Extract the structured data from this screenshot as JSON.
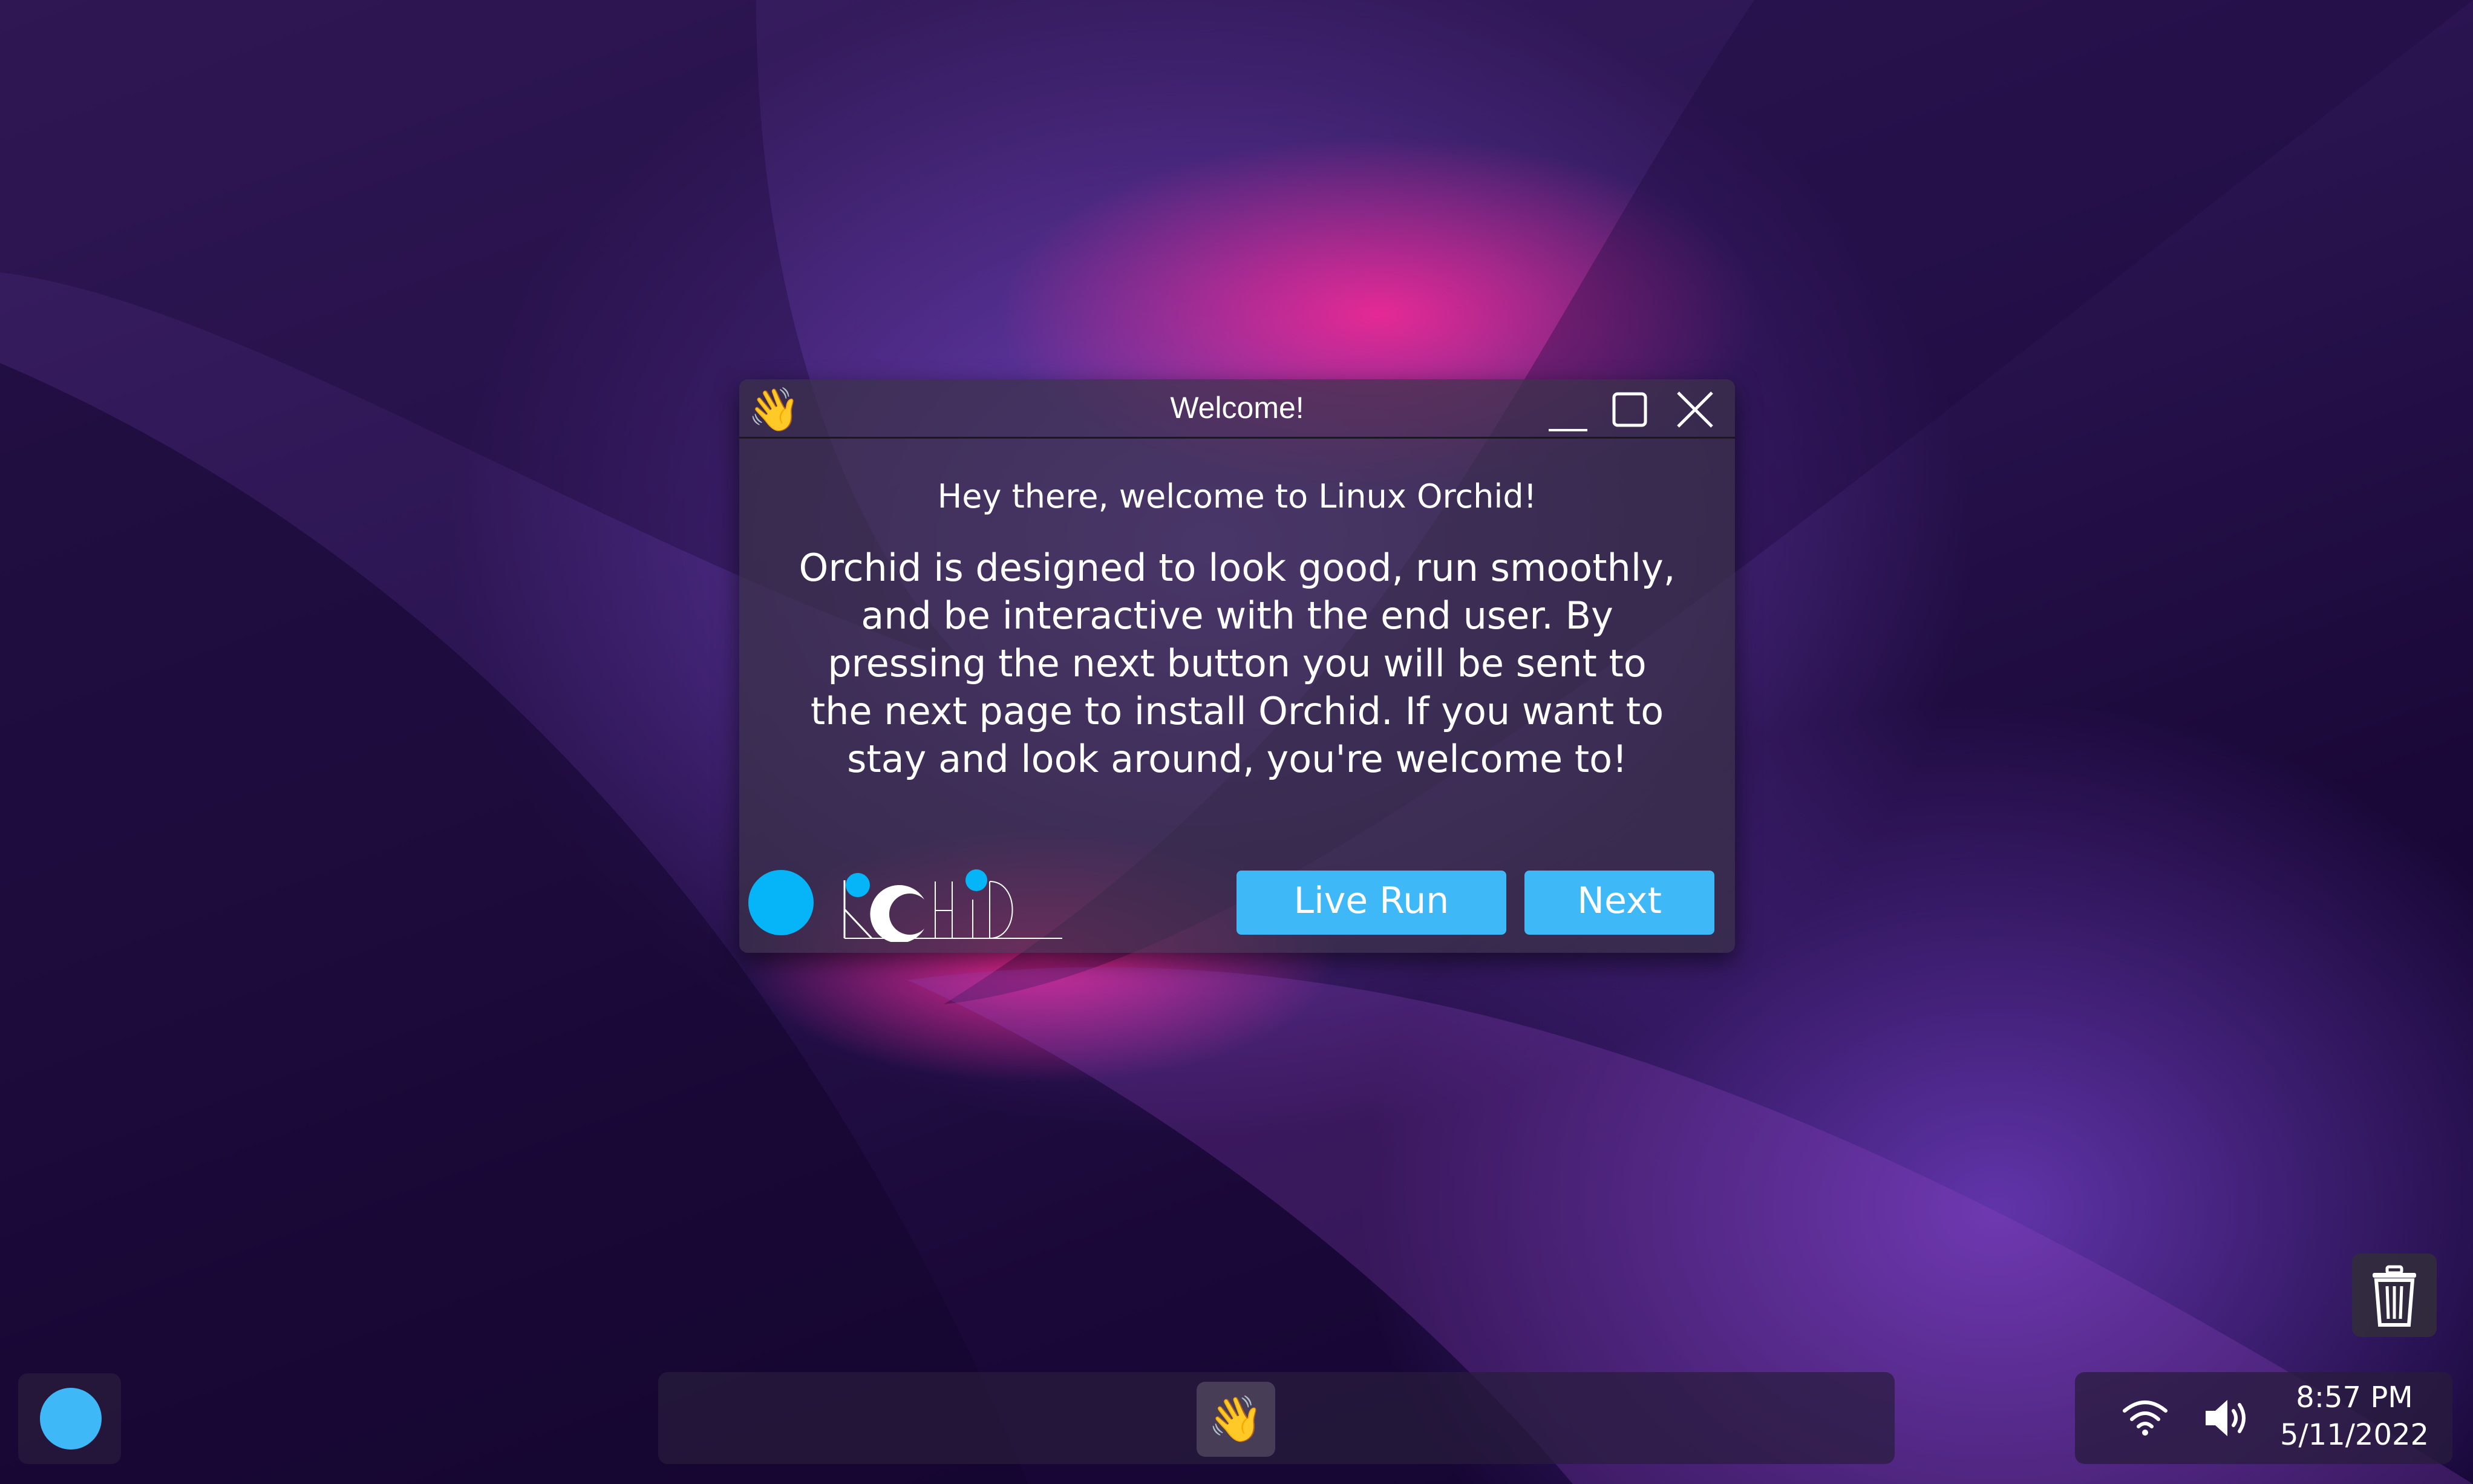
{
  "window": {
    "title": "Welcome!",
    "title_icon": "👋",
    "greeting": "Hey there, welcome to Linux Orchid!",
    "description": "Orchid is designed to look good, run smoothly, and be interactive with the end user. By pressing the next button you will be sent to the next page to install Orchid. If you want to stay and look around, you're welcome to!",
    "buttons": {
      "live_run": "Live Run",
      "next": "Next"
    },
    "controls": [
      "minimize-icon",
      "maximize-icon",
      "close-icon"
    ]
  },
  "taskbar": {
    "launcher_icon": "orchid-launcher-dot",
    "running_apps": [
      {
        "name": "Welcome",
        "icon": "👋"
      }
    ]
  },
  "tray": {
    "icons": [
      "wifi-icon",
      "volume-icon"
    ],
    "time": "8:57 PM",
    "date": "5/11/2022"
  },
  "desktop": {
    "icons": [
      "trash-icon"
    ]
  },
  "colors": {
    "accent": "#3fb8f8",
    "window_bg": "#3a3248",
    "text": "#ffffff"
  }
}
